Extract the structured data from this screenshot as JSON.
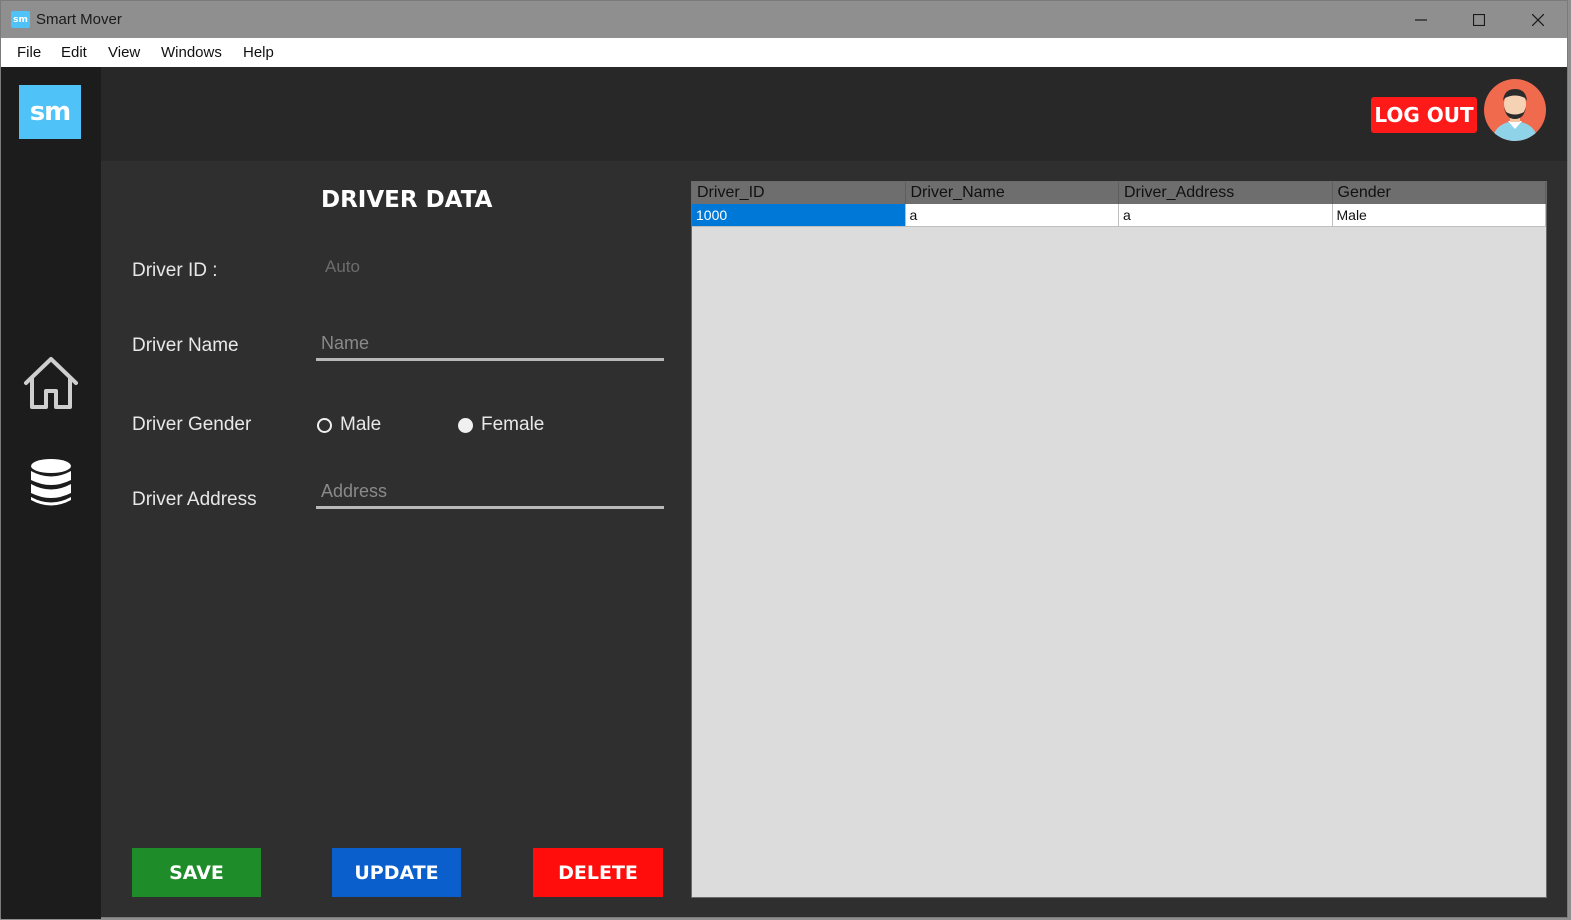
{
  "window": {
    "title": "Smart Mover",
    "icon_text": "sm",
    "controls": [
      "minimize-icon",
      "maximize-icon",
      "close-icon"
    ]
  },
  "menu": {
    "items": [
      "File",
      "Edit",
      "View",
      "Windows",
      "Help"
    ]
  },
  "sidebar": {
    "logo_text": "sm",
    "icons": [
      "home-icon",
      "database-icon"
    ]
  },
  "header": {
    "logout_label": "LOG OUT"
  },
  "form": {
    "title": "DRIVER DATA",
    "id_label": "Driver ID :",
    "id_value": "Auto",
    "name_label": "Driver Name",
    "name_placeholder": "Name",
    "gender_label": "Driver Gender",
    "gender_options": [
      "Male",
      "Female"
    ],
    "gender_selected": "Female",
    "address_label": "Driver Address",
    "address_placeholder": "Address"
  },
  "buttons": {
    "save": "SAVE",
    "update": "UPDATE",
    "delete": "DELETE"
  },
  "table": {
    "columns": [
      "Driver_ID",
      "Driver_Name",
      "Driver_Address",
      "Gender"
    ],
    "rows": [
      [
        "1000",
        "a",
        "a",
        "Male"
      ]
    ]
  },
  "colors": {
    "accent": "#4fc3f7",
    "save": "#1e8c28",
    "update": "#0a5fcc",
    "delete": "#ff0d0d",
    "logout": "#ff1a1a",
    "selection": "#0078d7"
  }
}
